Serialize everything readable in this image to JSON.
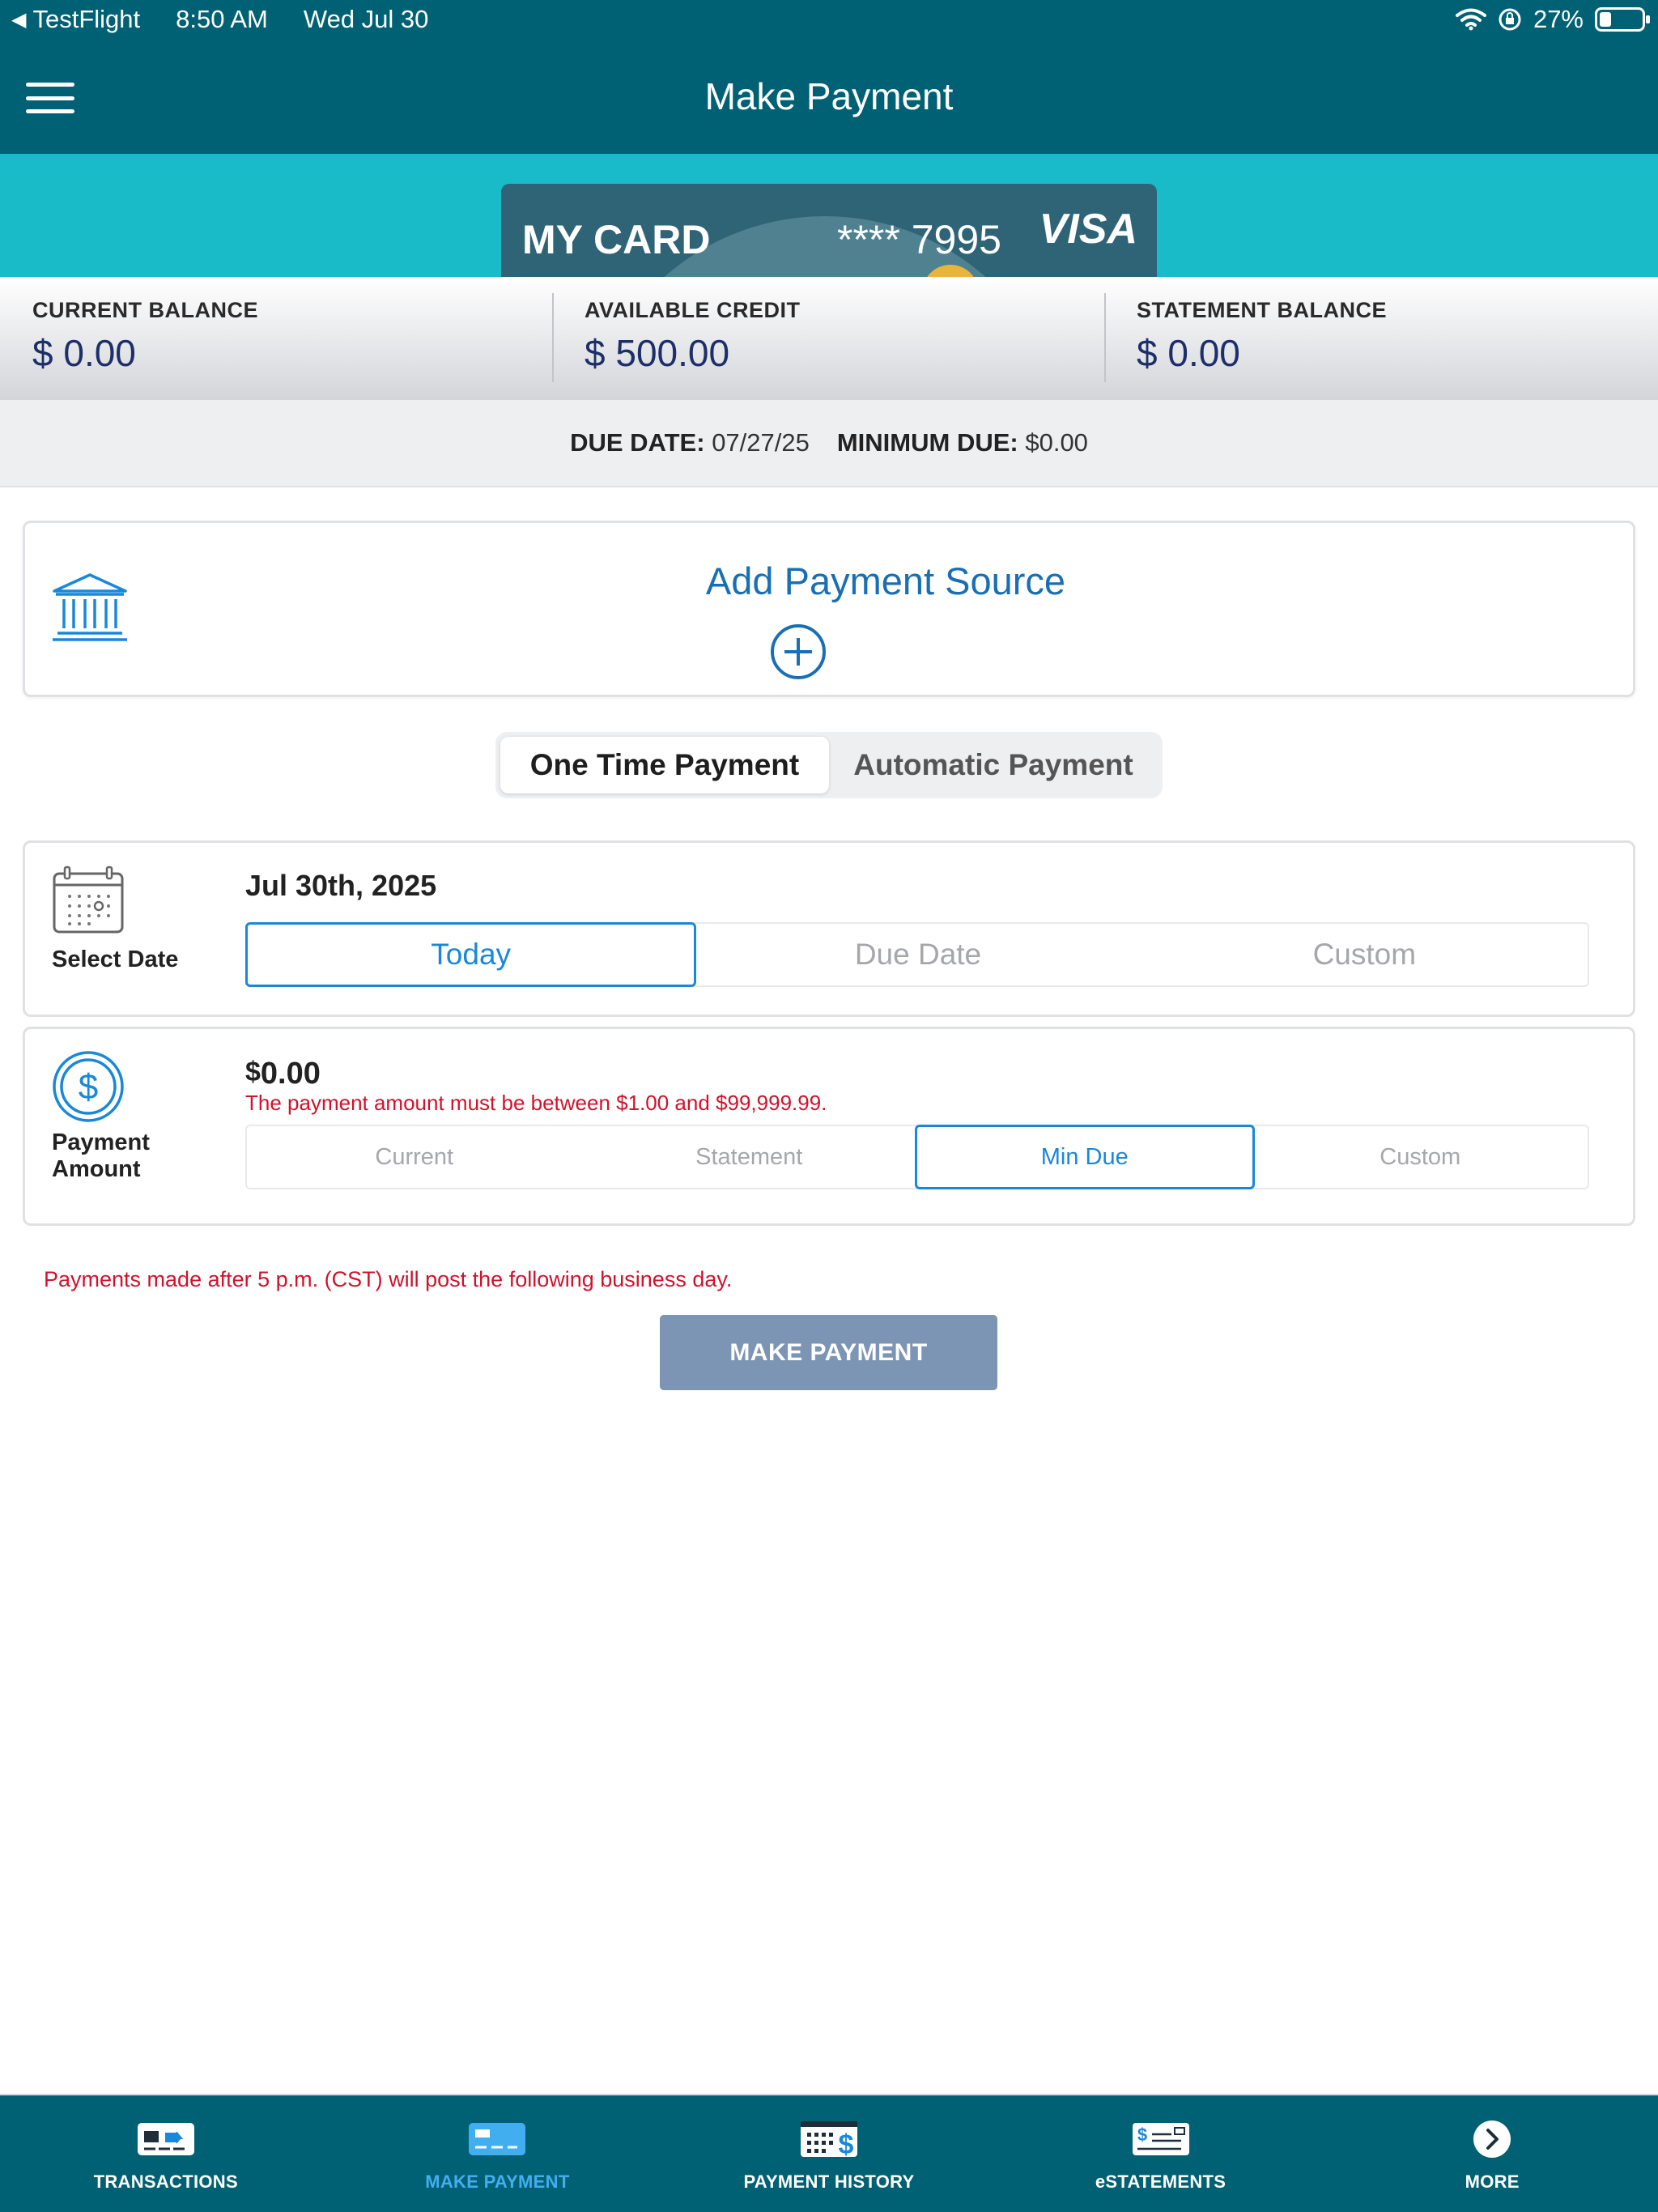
{
  "status_bar": {
    "back_app": "TestFlight",
    "time": "8:50 AM",
    "date": "Wed Jul 30",
    "battery": "27%",
    "battery_fraction": 0.27
  },
  "header": {
    "title": "Make Payment"
  },
  "card": {
    "name": "MY CARD",
    "number": "**** 7995",
    "brand": "VISA"
  },
  "balances": [
    {
      "label": "CURRENT BALANCE",
      "value": "$ 0.00"
    },
    {
      "label": "AVAILABLE CREDIT",
      "value": "$ 500.00"
    },
    {
      "label": "STATEMENT BALANCE",
      "value": "$ 0.00"
    }
  ],
  "due": {
    "due_date_label": "DUE DATE:",
    "due_date": "07/27/25",
    "min_due_label": "MINIMUM DUE:",
    "min_due": "$0.00"
  },
  "payment_source": {
    "title": "Add Payment Source"
  },
  "payment_type": {
    "options": [
      "One Time Payment",
      "Automatic Payment"
    ],
    "selected": "One Time Payment"
  },
  "select_date": {
    "label": "Select Date",
    "value": "Jul 30th, 2025",
    "options": [
      "Today",
      "Due Date",
      "Custom"
    ],
    "selected": "Today"
  },
  "payment_amount": {
    "label_line1": "Payment",
    "label_line2": "Amount",
    "currency_symbol": "$",
    "value": "0.00",
    "error": "The payment amount must be between $1.00 and $99,999.99.",
    "options": [
      "Current",
      "Statement",
      "Min Due",
      "Custom"
    ],
    "selected": "Min Due"
  },
  "notice": "Payments made after 5 p.m. (CST) will post the following business day.",
  "make_payment_button": "MAKE PAYMENT",
  "tabbar": [
    {
      "label": "TRANSACTIONS",
      "icon": "transactions-icon"
    },
    {
      "label": "MAKE PAYMENT",
      "icon": "make-payment-icon",
      "active": true
    },
    {
      "label": "PAYMENT HISTORY",
      "icon": "payment-history-icon"
    },
    {
      "label": "eSTATEMENTS",
      "icon": "estatements-icon"
    },
    {
      "label": "MORE",
      "icon": "more-icon"
    }
  ],
  "colors": {
    "header": "#006174",
    "card_band": "#19bbc9",
    "accent_blue": "#1a6fb4",
    "selected_blue": "#1a88d8",
    "error_red": "#d0122c",
    "button_disabled": "#7c95b4",
    "active_tab": "#41aef0"
  }
}
